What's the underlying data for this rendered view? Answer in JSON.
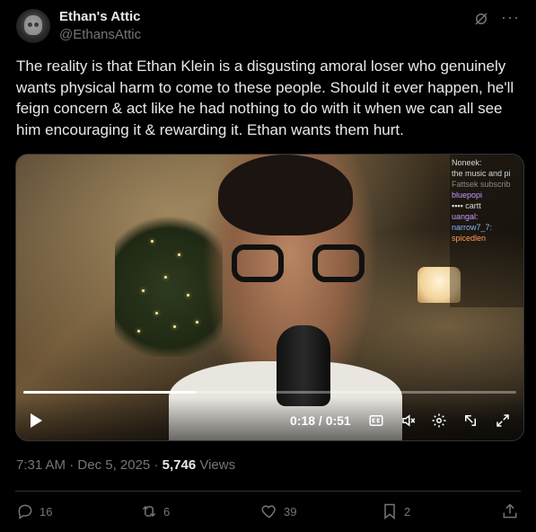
{
  "author": {
    "name": "Ethan's Attic",
    "handle": "@EthansAttic"
  },
  "header": {
    "grok_icon": "grok-icon",
    "more_icon": "more-icon",
    "more_glyph": "···"
  },
  "tweet": {
    "text": "The reality is that Ethan Klein is a disgusting amoral loser who genuinely wants physical harm to come to these people. Should it ever happen, he'll feign concern & act like he had nothing to do with it when we can all see him encouraging it & rewarding it. Ethan wants them hurt."
  },
  "video": {
    "time": "0:18 / 0:51",
    "progress": 0.35,
    "chat": [
      {
        "text": "Noneek:",
        "cls": "c-blue"
      },
      {
        "text": "the music and pi",
        "cls": ""
      },
      {
        "text": "Fattsek subscrib",
        "cls": "c-dim"
      },
      {
        "text": "bluepopi",
        "cls": "c-purple"
      },
      {
        "text": "▪▪▪▪ cartt",
        "cls": ""
      },
      {
        "text": "uangal:",
        "cls": "c-purple"
      },
      {
        "text": "narrow7_7:",
        "cls": "c-blue"
      },
      {
        "text": "spicedlen",
        "cls": "c-orange"
      }
    ],
    "controls": [
      "play-icon",
      "captions-icon",
      "mute-icon",
      "settings-icon",
      "pop-out-icon",
      "fullscreen-icon"
    ]
  },
  "meta": {
    "time": "7:31 AM",
    "date": "Dec 5, 2025",
    "separator": " · ",
    "views_count": "5,746",
    "views_label": " Views"
  },
  "actions": {
    "replies": "16",
    "reposts": "6",
    "likes": "39",
    "bookmarks": "2"
  },
  "colors": {
    "background": "#000000",
    "text": "#e7e9ea",
    "muted": "#71767b",
    "divider": "#2f3336"
  }
}
